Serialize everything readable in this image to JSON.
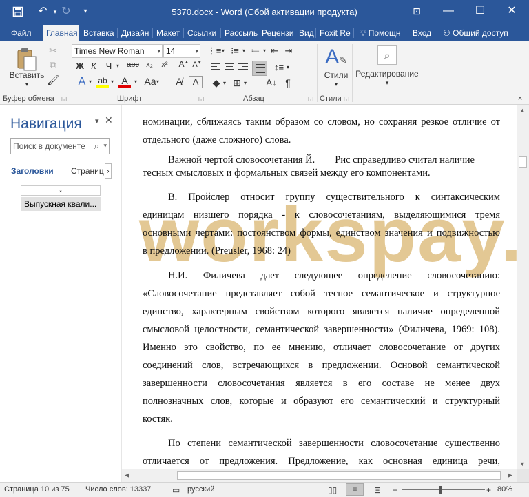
{
  "window": {
    "title": "5370.docx - Word (Сбой активации продукта)"
  },
  "tabs": [
    {
      "label": "Файл",
      "active": false
    },
    {
      "label": "Главная",
      "active": true
    },
    {
      "label": "Вставка",
      "active": false
    },
    {
      "label": "Дизайн",
      "active": false
    },
    {
      "label": "Макет",
      "active": false
    },
    {
      "label": "Ссылки",
      "active": false
    },
    {
      "label": "Рассыль",
      "active": false
    },
    {
      "label": "Рецензи",
      "active": false
    },
    {
      "label": "Вид",
      "active": false
    },
    {
      "label": "Foxit Re",
      "active": false
    }
  ],
  "tell_me": "Помощн",
  "signin": "Вход",
  "share": "Общий доступ",
  "ribbon": {
    "paste_label": "Вставить",
    "clipboard_label": "Буфер обмена",
    "font_name": "Times New Roman",
    "font_size": "14",
    "font_label": "Шрифт",
    "paragraph_label": "Абзац",
    "styles_btn": "Стили",
    "styles_label": "Стили",
    "editing_label": "Редактирование"
  },
  "nav": {
    "title": "Навигация",
    "search_placeholder": "Поиск в документе",
    "tab_headings": "Заголовки",
    "tab_pages": "Страниц",
    "heading_item": "Выпускная квали..."
  },
  "document": {
    "lines": [
      "номинации, сближаясь таким образом со словом, но сохраняя резкое отличие от",
      "отдельного (даже сложного) слова.",
      "Важной чертой словосочетания Й.        Рис справедливо считал наличие",
      "тесных смысловых и формальных связей между его компонентами.",
      "В. Пройслер относит группу существительного к синтаксическим",
      "единицам низшего порядка - к словосочетаниям, выделяющимися тремя",
      "основными чертами: постоянством формы, единством значения и подвижностью",
      "в предложении. (Preusler, 1968: 24)",
      "Н.И. Филичева дает следующее определение словосочетанию:",
      "«Словосочетание представляет собой тесное семантическое и структурное",
      "единство, характерным свойством которого является наличие определенной",
      "смысловой целостности, семантической завершенности» (Филичева, 1969: 108).",
      "Именно это свойство, по ее мнению, отличает словосочетание от других",
      "соединений слов, встречающихся в предложении. Основой семантической",
      "завершенности словосочетания является в его составе не менее двух",
      "полнозначных слов, которые и образуют его семантический и структурный",
      "костяк.",
      "По степени семантической завершенности словосочетание существенно",
      "отличается от предложения. Предложение, как основная единица речи,"
    ],
    "watermark": "workspay.ru"
  },
  "status": {
    "page": "Страница 10 из 75",
    "words": "Число слов: 13337",
    "language": "русский",
    "zoom": "80%"
  }
}
